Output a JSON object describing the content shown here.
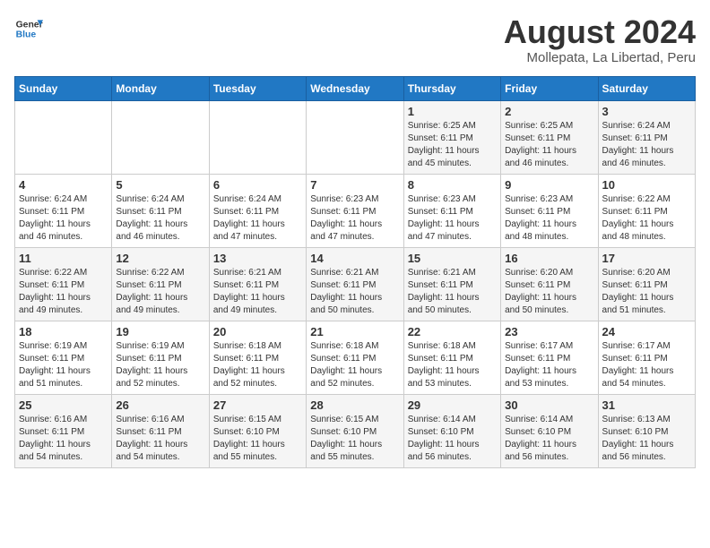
{
  "logo": {
    "line1": "General",
    "line2": "Blue"
  },
  "title": "August 2024",
  "subtitle": "Mollepata, La Libertad, Peru",
  "headers": [
    "Sunday",
    "Monday",
    "Tuesday",
    "Wednesday",
    "Thursday",
    "Friday",
    "Saturday"
  ],
  "weeks": [
    [
      {
        "day": "",
        "detail": ""
      },
      {
        "day": "",
        "detail": ""
      },
      {
        "day": "",
        "detail": ""
      },
      {
        "day": "",
        "detail": ""
      },
      {
        "day": "1",
        "detail": "Sunrise: 6:25 AM\nSunset: 6:11 PM\nDaylight: 11 hours\nand 45 minutes."
      },
      {
        "day": "2",
        "detail": "Sunrise: 6:25 AM\nSunset: 6:11 PM\nDaylight: 11 hours\nand 46 minutes."
      },
      {
        "day": "3",
        "detail": "Sunrise: 6:24 AM\nSunset: 6:11 PM\nDaylight: 11 hours\nand 46 minutes."
      }
    ],
    [
      {
        "day": "4",
        "detail": "Sunrise: 6:24 AM\nSunset: 6:11 PM\nDaylight: 11 hours\nand 46 minutes."
      },
      {
        "day": "5",
        "detail": "Sunrise: 6:24 AM\nSunset: 6:11 PM\nDaylight: 11 hours\nand 46 minutes."
      },
      {
        "day": "6",
        "detail": "Sunrise: 6:24 AM\nSunset: 6:11 PM\nDaylight: 11 hours\nand 47 minutes."
      },
      {
        "day": "7",
        "detail": "Sunrise: 6:23 AM\nSunset: 6:11 PM\nDaylight: 11 hours\nand 47 minutes."
      },
      {
        "day": "8",
        "detail": "Sunrise: 6:23 AM\nSunset: 6:11 PM\nDaylight: 11 hours\nand 47 minutes."
      },
      {
        "day": "9",
        "detail": "Sunrise: 6:23 AM\nSunset: 6:11 PM\nDaylight: 11 hours\nand 48 minutes."
      },
      {
        "day": "10",
        "detail": "Sunrise: 6:22 AM\nSunset: 6:11 PM\nDaylight: 11 hours\nand 48 minutes."
      }
    ],
    [
      {
        "day": "11",
        "detail": "Sunrise: 6:22 AM\nSunset: 6:11 PM\nDaylight: 11 hours\nand 49 minutes."
      },
      {
        "day": "12",
        "detail": "Sunrise: 6:22 AM\nSunset: 6:11 PM\nDaylight: 11 hours\nand 49 minutes."
      },
      {
        "day": "13",
        "detail": "Sunrise: 6:21 AM\nSunset: 6:11 PM\nDaylight: 11 hours\nand 49 minutes."
      },
      {
        "day": "14",
        "detail": "Sunrise: 6:21 AM\nSunset: 6:11 PM\nDaylight: 11 hours\nand 50 minutes."
      },
      {
        "day": "15",
        "detail": "Sunrise: 6:21 AM\nSunset: 6:11 PM\nDaylight: 11 hours\nand 50 minutes."
      },
      {
        "day": "16",
        "detail": "Sunrise: 6:20 AM\nSunset: 6:11 PM\nDaylight: 11 hours\nand 50 minutes."
      },
      {
        "day": "17",
        "detail": "Sunrise: 6:20 AM\nSunset: 6:11 PM\nDaylight: 11 hours\nand 51 minutes."
      }
    ],
    [
      {
        "day": "18",
        "detail": "Sunrise: 6:19 AM\nSunset: 6:11 PM\nDaylight: 11 hours\nand 51 minutes."
      },
      {
        "day": "19",
        "detail": "Sunrise: 6:19 AM\nSunset: 6:11 PM\nDaylight: 11 hours\nand 52 minutes."
      },
      {
        "day": "20",
        "detail": "Sunrise: 6:18 AM\nSunset: 6:11 PM\nDaylight: 11 hours\nand 52 minutes."
      },
      {
        "day": "21",
        "detail": "Sunrise: 6:18 AM\nSunset: 6:11 PM\nDaylight: 11 hours\nand 52 minutes."
      },
      {
        "day": "22",
        "detail": "Sunrise: 6:18 AM\nSunset: 6:11 PM\nDaylight: 11 hours\nand 53 minutes."
      },
      {
        "day": "23",
        "detail": "Sunrise: 6:17 AM\nSunset: 6:11 PM\nDaylight: 11 hours\nand 53 minutes."
      },
      {
        "day": "24",
        "detail": "Sunrise: 6:17 AM\nSunset: 6:11 PM\nDaylight: 11 hours\nand 54 minutes."
      }
    ],
    [
      {
        "day": "25",
        "detail": "Sunrise: 6:16 AM\nSunset: 6:11 PM\nDaylight: 11 hours\nand 54 minutes."
      },
      {
        "day": "26",
        "detail": "Sunrise: 6:16 AM\nSunset: 6:11 PM\nDaylight: 11 hours\nand 54 minutes."
      },
      {
        "day": "27",
        "detail": "Sunrise: 6:15 AM\nSunset: 6:10 PM\nDaylight: 11 hours\nand 55 minutes."
      },
      {
        "day": "28",
        "detail": "Sunrise: 6:15 AM\nSunset: 6:10 PM\nDaylight: 11 hours\nand 55 minutes."
      },
      {
        "day": "29",
        "detail": "Sunrise: 6:14 AM\nSunset: 6:10 PM\nDaylight: 11 hours\nand 56 minutes."
      },
      {
        "day": "30",
        "detail": "Sunrise: 6:14 AM\nSunset: 6:10 PM\nDaylight: 11 hours\nand 56 minutes."
      },
      {
        "day": "31",
        "detail": "Sunrise: 6:13 AM\nSunset: 6:10 PM\nDaylight: 11 hours\nand 56 minutes."
      }
    ]
  ]
}
